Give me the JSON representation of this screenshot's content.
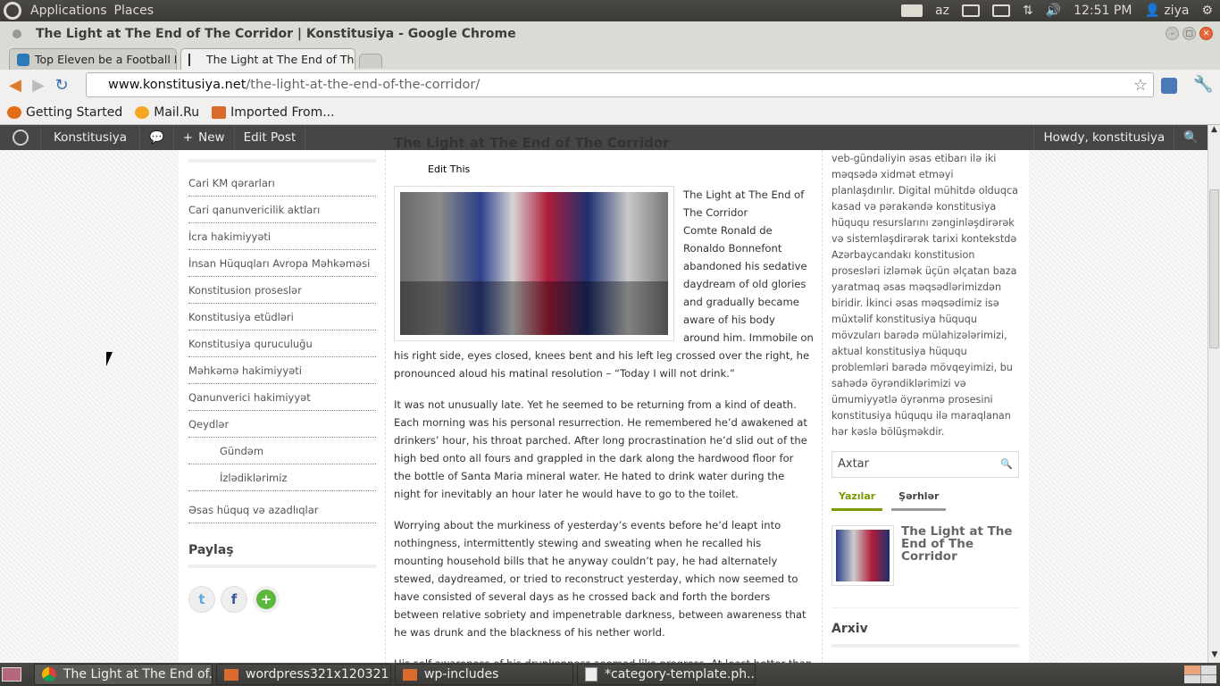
{
  "top_panel": {
    "applications": "Applications",
    "places": "Places",
    "keyboard": "az",
    "time": "12:51 PM",
    "user": "ziya"
  },
  "window": {
    "title": "The Light at The End of The Corridor | Konstitusiya - Google Chrome"
  },
  "tabs": [
    {
      "label": "Top Eleven be a Football M"
    },
    {
      "label": "The Light at The End of Th"
    }
  ],
  "address": {
    "host": "www.konstitusiya.net",
    "path": "/the-light-at-the-end-of-the-corridor/"
  },
  "bookmarks": [
    "Getting Started",
    "Mail.Ru",
    "Imported From..."
  ],
  "adminbar": {
    "site": "Konstitusiya",
    "new": "New",
    "edit": "Edit Post",
    "howdy": "Howdy, konstitusiya"
  },
  "categories": [
    {
      "label": "Cari KM qərarları",
      "sub": false
    },
    {
      "label": "Cari qanunvericilik aktları",
      "sub": false
    },
    {
      "label": "İcra hakimiyyəti",
      "sub": false
    },
    {
      "label": "İnsan Hüquqları Avropa Məhkəməsi",
      "sub": false
    },
    {
      "label": "Konstitusion proseslər",
      "sub": false
    },
    {
      "label": "Konstitusiya etüdləri",
      "sub": false
    },
    {
      "label": "Konstitusiya quruculuğu",
      "sub": false
    },
    {
      "label": "Məhkəmə hakimiyyəti",
      "sub": false
    },
    {
      "label": "Qanunverici hakimiyyət",
      "sub": false
    },
    {
      "label": "Qeydlər",
      "sub": false
    },
    {
      "label": "Gündəm",
      "sub": true
    },
    {
      "label": "İzlədiklərimiz",
      "sub": true
    },
    {
      "label": "Əsas hüquq və azadlıqlar",
      "sub": false
    }
  ],
  "share": {
    "title": "Paylaş"
  },
  "post": {
    "title": "The Light at The End of The Corridor",
    "edit": "Edit This",
    "caption_title": "The Light at The End of The Corridor",
    "p1": "Comte Ronald de Ronaldo Bonnefont abandoned his sedative daydream of old glories and gradually became aware of his body around him. Immobile on his right side, eyes closed, knees bent and his left leg crossed over the right, he pronounced aloud his matinal resolution – “Today I will not drink.”",
    "p2": "It was not unusually late. Yet he seemed to be returning from a kind of death. Each morning was his personal resurrection. He remembered he’d awakened at drinkers’ hour, his throat parched. After long procrastination he’d slid out of the high bed onto all fours and grappled in the dark along the hardwood floor for the bottle of Santa Maria mineral water. He hated to drink water during the night for inevitably an hour later he would have to go to the toilet.",
    "p3": "Worrying about the murkiness of yesterday’s events before he’d leapt into nothingness, intermittently stewing and sweating when he recalled his mounting household bills that he anyway couldn’t pay, he had alternately stewed, daydreamed, or tried to reconstruct yesterday, which now seemed to have consisted of several days as he crossed back and forth the borders between relative sobriety and impenetrable darkness, between awareness that he was drunk and the blackness of his nether world.",
    "p4": "His self-awareness of his drunkenness seemed like progress. At least better than"
  },
  "sidebar": {
    "about": "veb-gündəliyin əsas etibarı ilə iki məqsədə xidmət etməyi planlaşdırılır. Digital mühitdə olduqca kasad və pərakəndə konstitusiya hüququ resurslarını zənginləşdirərək və sistemləşdirərək tarixi kontekstdə Azərbaycandakı konstitusion prosesləri izləmək üçün əlçatan baza yaratmaq əsas məqsədlərimizdən biridir. İkinci əsas məqsədimiz isə müxtəlif konstitusiya hüququ mövzuları barədə mülahizələrimizi, aktual konstitusiya hüququ problemləri barədə mövqeyimizi, bu sahədə öyrəndiklərimizi və ümumiyyətlə öyrənmə prosesini konstitusiya hüququ ilə maraqlanan hər kəslə bölüşməkdir.",
    "search_placeholder": "Axtar",
    "tab_posts": "Yazılar",
    "tab_comments": "Şərhlər",
    "recent_title": "The Light at The End of The Corridor",
    "archive": "Arxiv"
  },
  "taskbar": [
    "The Light at The End of...",
    "wordpress321x120321...",
    "wp-includes",
    "*category-template.ph..."
  ],
  "colors": {
    "accent": "#7a9a01",
    "adminbar": "#464646",
    "link": "#555555"
  }
}
